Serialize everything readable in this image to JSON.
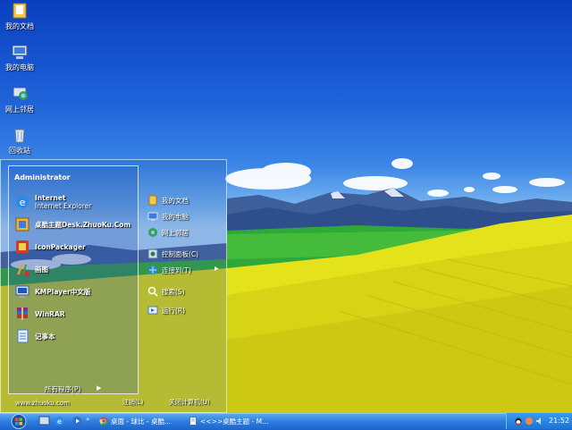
{
  "desktop": {
    "icons": [
      {
        "label": "我的文档",
        "icon": "folder-docs-icon"
      },
      {
        "label": "我的电脑",
        "icon": "computer-icon"
      },
      {
        "label": "网上邻居",
        "icon": "network-icon"
      },
      {
        "label": "回收站",
        "icon": "recycle-bin-icon"
      }
    ]
  },
  "start_menu": {
    "user": "Administrator",
    "programs": [
      {
        "label": "Internet",
        "sub": "Internet Explorer",
        "icon": "internet-explorer-icon"
      },
      {
        "label": "桌酷主题Desk.ZhuoKu.Com",
        "icon": "zhuoku-icon"
      },
      {
        "label": "IconPackager",
        "icon": "iconpackager-icon"
      },
      {
        "label": "画图",
        "icon": "paint-icon"
      },
      {
        "label": "KMPlayer中文版",
        "icon": "kmplayer-icon"
      },
      {
        "label": "WinRAR",
        "icon": "winrar-icon"
      },
      {
        "label": "记事本",
        "icon": "notepad-icon"
      }
    ],
    "all_programs": "所有程序(P)",
    "places": [
      {
        "label": "我的文档",
        "icon": "folder-docs-icon"
      },
      {
        "label": "我的电脑",
        "icon": "computer-icon"
      },
      {
        "label": "网上邻居",
        "icon": "network-icon"
      },
      {
        "label": "控制面板(C)",
        "icon": "control-panel-icon"
      },
      {
        "label": "连接到(T)",
        "icon": "connect-icon"
      },
      {
        "label": "搜索(S)",
        "icon": "search-icon"
      },
      {
        "label": "运行(R)",
        "icon": "run-icon"
      }
    ],
    "bottom_left": "www.zhuoku.com",
    "logoff": "注销(L)",
    "shutdown": "关闭计算机(U)"
  },
  "taskbar": {
    "tasks": [
      {
        "label": "桌面 - 球比 - 桌酷...",
        "icon": "chrome-icon"
      },
      {
        "label": "<<>>桌酷主题 - M...",
        "icon": "document-icon"
      }
    ],
    "clock": "21:52"
  },
  "colors": {
    "taskbar": "#2e7fe0",
    "sky": "#1f63d9",
    "field": "#e4e21a",
    "grass": "#2fa83a"
  }
}
